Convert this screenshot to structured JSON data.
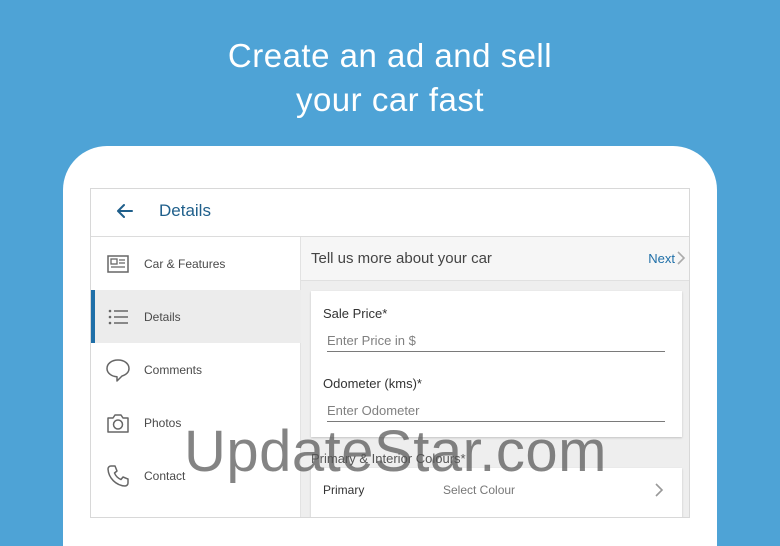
{
  "headline": {
    "line1": "Create an ad and sell",
    "line2": "your car fast"
  },
  "appbar": {
    "title": "Details",
    "back_icon": "arrow-left-icon"
  },
  "sidebar": {
    "items": [
      {
        "label": "Car & Features",
        "icon": "document-icon",
        "active": false
      },
      {
        "label": "Details",
        "icon": "list-icon",
        "active": true
      },
      {
        "label": "Comments",
        "icon": "chat-bubble-icon",
        "active": false
      },
      {
        "label": "Photos",
        "icon": "camera-icon",
        "active": false
      },
      {
        "label": "Contact",
        "icon": "phone-icon",
        "active": false
      }
    ]
  },
  "content": {
    "title": "Tell us more about your car",
    "next_label": "Next",
    "sale_price": {
      "label": "Sale Price*",
      "placeholder": "Enter Price in $",
      "value": ""
    },
    "odometer": {
      "label": "Odometer (kms)*",
      "placeholder": "Enter Odometer",
      "value": ""
    },
    "colours_section": "Primary & Interior Colours*",
    "primary_row": {
      "label": "Primary",
      "value": "Select Colour"
    }
  },
  "watermark": "UpdateStar.com",
  "colors": {
    "background": "#4ea3d6",
    "accent": "#1f6fa8",
    "title_blue": "#1f5f8b"
  }
}
